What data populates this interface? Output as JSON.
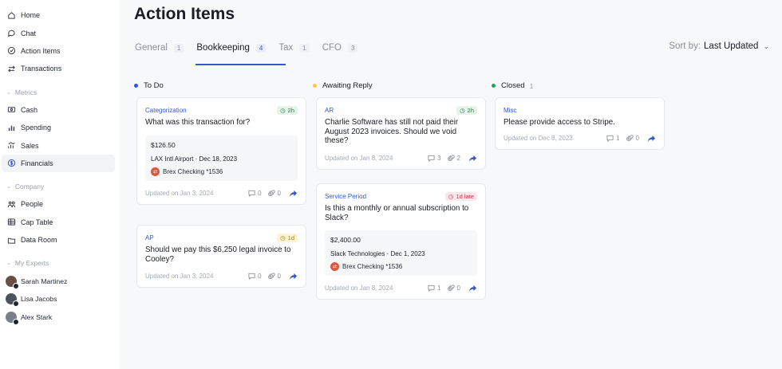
{
  "sidebar": {
    "items": [
      {
        "label": "Home",
        "icon": "home-icon"
      },
      {
        "label": "Chat",
        "icon": "chat-icon"
      },
      {
        "label": "Action Items",
        "icon": "check-circle-icon"
      },
      {
        "label": "Transactions",
        "icon": "swap-icon"
      }
    ],
    "metrics_header": "Metrics",
    "metrics": [
      {
        "label": "Cash",
        "icon": "cash-icon"
      },
      {
        "label": "Spending",
        "icon": "bar-chart-icon"
      },
      {
        "label": "Sales",
        "icon": "sales-icon"
      },
      {
        "label": "Financials",
        "icon": "dollar-circle-icon"
      }
    ],
    "company_header": "Company",
    "company": [
      {
        "label": "People",
        "icon": "people-icon"
      },
      {
        "label": "Cap Table",
        "icon": "table-icon"
      },
      {
        "label": "Data Room",
        "icon": "folder-icon"
      }
    ],
    "experts_header": "My Experts",
    "experts": [
      {
        "name": "Sarah Martinez"
      },
      {
        "name": "Lisa Jacobs"
      },
      {
        "name": "Alex Stark"
      }
    ]
  },
  "main": {
    "title": "Action Items",
    "tabs": [
      {
        "label": "General",
        "count": "1"
      },
      {
        "label": "Bookkeeping",
        "count": "4"
      },
      {
        "label": "Tax",
        "count": "1"
      },
      {
        "label": "CFO",
        "count": "3"
      }
    ],
    "sort_label": "Sort by:",
    "sort_value": "Last Updated"
  },
  "columns": {
    "todo": {
      "label": "To Do",
      "color": "#3358d4"
    },
    "awaiting": {
      "label": "Awaiting Reply",
      "color": "#f2c94c"
    },
    "closed": {
      "label": "Closed",
      "count": "1",
      "color": "#27a05a"
    }
  },
  "cards": {
    "c1": {
      "category": "Categorization",
      "time": "2h",
      "title": "What was this transaction for?",
      "amount": "$126.50",
      "merchant": "LAX Intl Airport · Dec 18, 2023",
      "account": "Brex Checking *1536",
      "updated": "Updated on Jan 3, 2024",
      "comments": "0",
      "attachments": "0"
    },
    "c2": {
      "category": "AP",
      "time": "1d",
      "title": "Should we pay this $6,250 legal invoice to Cooley?",
      "updated": "Updated on Jan 3, 2024",
      "comments": "0",
      "attachments": "0"
    },
    "c3": {
      "category": "AR",
      "time": "2h",
      "title": "Charlie Software has still not paid their August 2023 invoices. Should we void these?",
      "updated": "Updated on Jan 8, 2024",
      "comments": "3",
      "attachments": "2"
    },
    "c4": {
      "category": "Service Period",
      "time": "1d late",
      "title": "Is this a monthly or annual subscription to Slack?",
      "amount": "$2,400.00",
      "merchant": "Slack Technologies · Dec 1, 2023",
      "account": "Brex Checking *1536",
      "updated": "Updated on Jan 8, 2024",
      "comments": "1",
      "attachments": "0"
    },
    "c5": {
      "category": "Misc",
      "title": "Please provide access to Stripe.",
      "updated": "Updated on Dec 8, 2023",
      "comments": "1",
      "attachments": "0"
    }
  }
}
